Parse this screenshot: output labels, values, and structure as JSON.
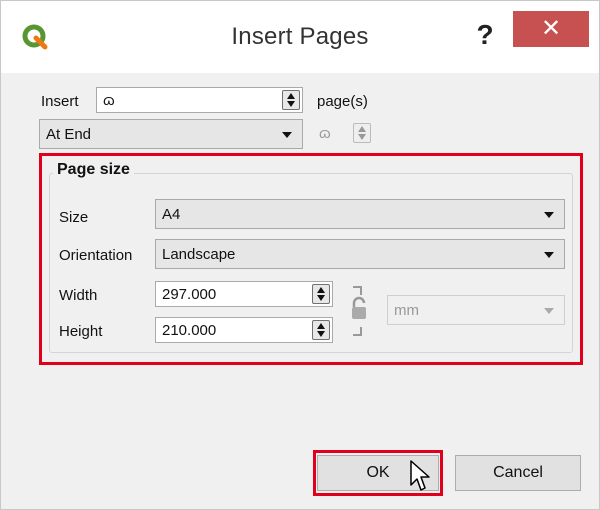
{
  "window": {
    "title": "Insert Pages",
    "help_label": "?",
    "close_label": "✕"
  },
  "insert": {
    "label": "Insert",
    "count_value": "ɷ",
    "suffix": "page(s)",
    "position_value": "At End",
    "after_page_value": "ɷ"
  },
  "page_size": {
    "title": "Page size",
    "size_label": "Size",
    "size_value": "A4",
    "orientation_label": "Orientation",
    "orientation_value": "Landscape",
    "width_label": "Width",
    "width_value": "297.000",
    "height_label": "Height",
    "height_value": "210.000",
    "units_value": "mm"
  },
  "buttons": {
    "ok": "OK",
    "cancel": "Cancel"
  },
  "colors": {
    "highlight": "#e0001b",
    "close_button": "#c75050",
    "qgis_green": "#589632"
  },
  "icons": [
    "qgis-logo-icon",
    "help-icon",
    "close-icon",
    "lock-open-icon",
    "mouse-cursor-icon"
  ]
}
